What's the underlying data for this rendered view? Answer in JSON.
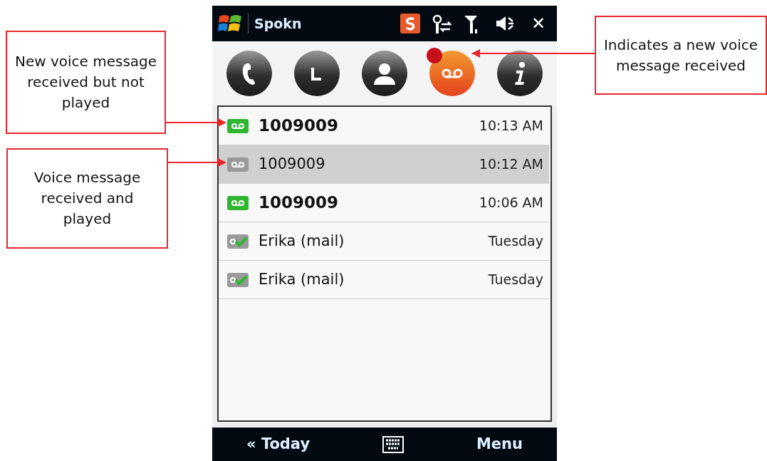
{
  "callouts": [
    {
      "text": "New voice message received but not played"
    },
    {
      "text": "Voice message received and played"
    },
    {
      "text": "Indicates  a new voice message received"
    }
  ],
  "title_bar": {
    "title": "Spokn",
    "status_icons": [
      {
        "kind": "app"
      },
      {
        "kind": "connection"
      },
      {
        "kind": "signal"
      },
      {
        "kind": "volume"
      }
    ],
    "close": "✕"
  },
  "toolbar": [
    {
      "kind": "phone",
      "selected": false,
      "new_message": false
    },
    {
      "kind": "history",
      "selected": false,
      "new_message": false
    },
    {
      "kind": "contacts",
      "selected": false,
      "new_message": false
    },
    {
      "kind": "voicemail",
      "selected": true,
      "new_message": true
    },
    {
      "kind": "info",
      "selected": false,
      "new_message": false
    }
  ],
  "messages": [
    {
      "kind": "voice",
      "caller": "1009009",
      "time": "10:13 AM",
      "played": false,
      "selected": false
    },
    {
      "kind": "voice",
      "caller": "1009009",
      "time": "10:12 AM",
      "played": true,
      "selected": true
    },
    {
      "kind": "voice",
      "caller": "1009009",
      "time": "10:06 AM",
      "played": false,
      "selected": false
    },
    {
      "kind": "mail",
      "caller": "Erika (mail)",
      "time": "Tuesday",
      "played": true,
      "selected": false
    },
    {
      "kind": "mail",
      "caller": "Erika (mail)",
      "time": "Tuesday",
      "played": true,
      "selected": false
    }
  ],
  "bottom_bar": {
    "left": "« Today",
    "right": "Menu"
  }
}
